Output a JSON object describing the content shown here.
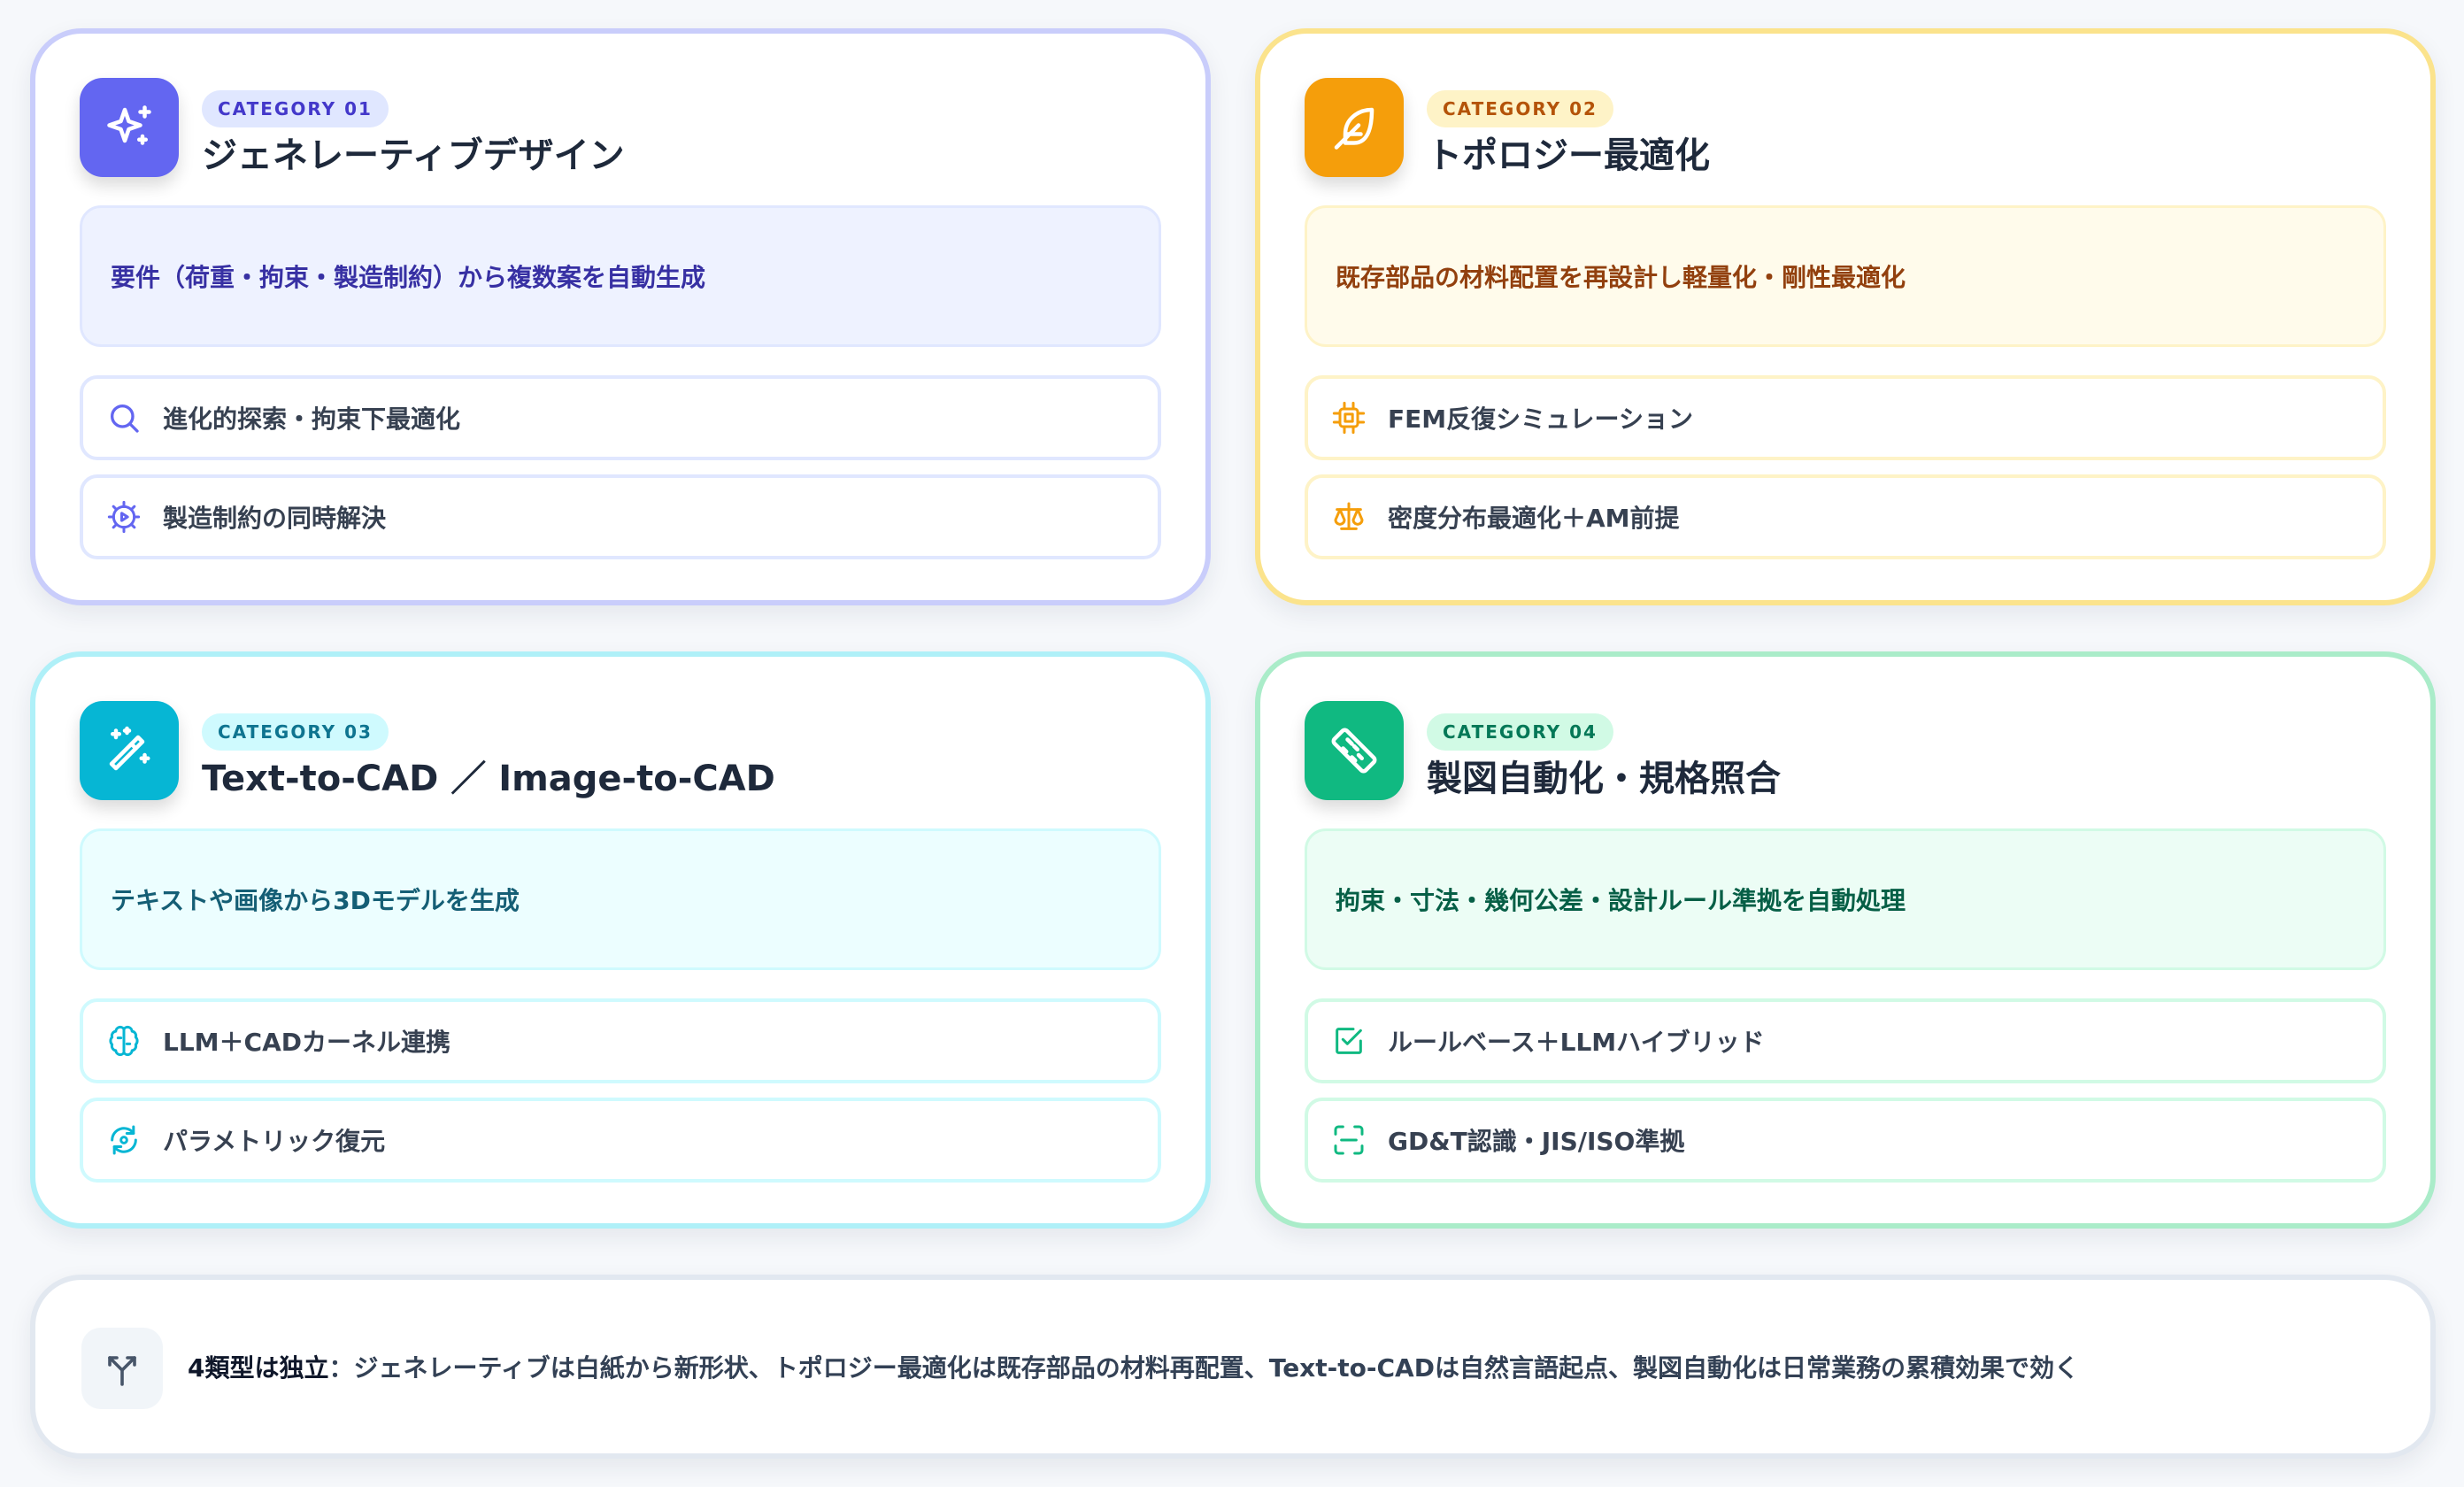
{
  "colors": {
    "indigo": "#6366f1",
    "amber": "#f59e0b",
    "cyan": "#06b6d4",
    "emerald": "#10b981"
  },
  "categories": [
    {
      "badge": "CATEGORY 01",
      "title": "ジェネレーティブデザイン",
      "icon": "sparkles-icon",
      "summary": "要件（荷重・拘束・製造制約）から複数案を自動生成",
      "features": [
        {
          "icon": "search-icon",
          "label": "進化的探索・拘束下最適化"
        },
        {
          "icon": "gear-play-icon",
          "label": "製造制約の同時解決"
        }
      ]
    },
    {
      "badge": "CATEGORY 02",
      "title": "トポロジー最適化",
      "icon": "feather-icon",
      "summary": "既存部品の材料配置を再設計し軽量化・剛性最適化",
      "features": [
        {
          "icon": "cpu-icon",
          "label": "FEM反復シミュレーション"
        },
        {
          "icon": "scale-icon",
          "label": "密度分布最適化＋AM前提"
        }
      ]
    },
    {
      "badge": "CATEGORY 03",
      "title": "Text-to-CAD ／ Image-to-CAD",
      "icon": "magic-wand-icon",
      "summary": "テキストや画像から3Dモデルを生成",
      "features": [
        {
          "icon": "brain-icon",
          "label": "LLM＋CADカーネル連携"
        },
        {
          "icon": "refresh-icon",
          "label": "パラメトリック復元"
        }
      ]
    },
    {
      "badge": "CATEGORY 04",
      "title": "製図自動化・規格照合",
      "icon": "ruler-icon",
      "summary": "拘束・寸法・幾何公差・設計ルール準拠を自動処理",
      "features": [
        {
          "icon": "checkbox-icon",
          "label": "ルールベース＋LLMハイブリッド"
        },
        {
          "icon": "scan-icon",
          "label": "GD&T認識・JIS/ISO準拠"
        }
      ]
    }
  ],
  "footer": {
    "icon": "split-arrow-icon",
    "lead": "4類型は独立",
    "text": "：ジェネレーティブは白紙から新形状、トポロジー最適化は既存部品の材料再配置、Text-to-CADは自然言語起点、製図自動化は日常業務の累積効果で効く"
  }
}
